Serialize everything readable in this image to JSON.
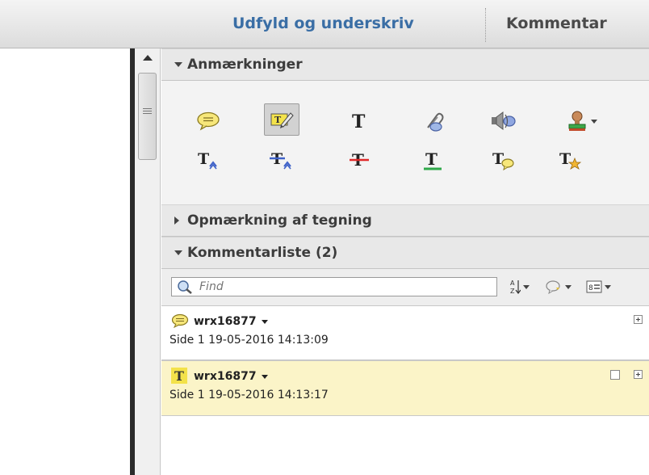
{
  "toolbar": {
    "fill_sign_label": "Udfyld og underskriv",
    "comment_label": "Kommentar"
  },
  "panel": {
    "annotations_header": "Anmærkninger",
    "drawing_header": "Opmærkning af tegning",
    "comment_list_header": "Kommentarliste (2)",
    "find_placeholder": "Find"
  },
  "tools": {
    "row1": [
      "sticky-note-icon",
      "highlight-text-icon",
      "add-text-box-icon",
      "attach-file-icon",
      "record-audio-icon",
      "stamp-icon"
    ],
    "row2": [
      "insert-text-icon",
      "replace-text-icon",
      "strikethrough-icon",
      "underline-icon",
      "text-comment-icon",
      "text-correction-icon"
    ],
    "selected": "highlight-text-icon"
  },
  "comments": [
    {
      "author": "wrx16877",
      "meta": "Side 1  19-05-2016 14:13:09",
      "type": "note-icon"
    },
    {
      "author": "wrx16877",
      "meta": "Side 1  19-05-2016 14:13:17",
      "type": "text-icon",
      "highlight_color": "#fbf4c8"
    }
  ],
  "colors": {
    "accent": "#3a6ea5",
    "note_yellow": "#f7e77a",
    "selected_comment": "#fbf4c8"
  }
}
